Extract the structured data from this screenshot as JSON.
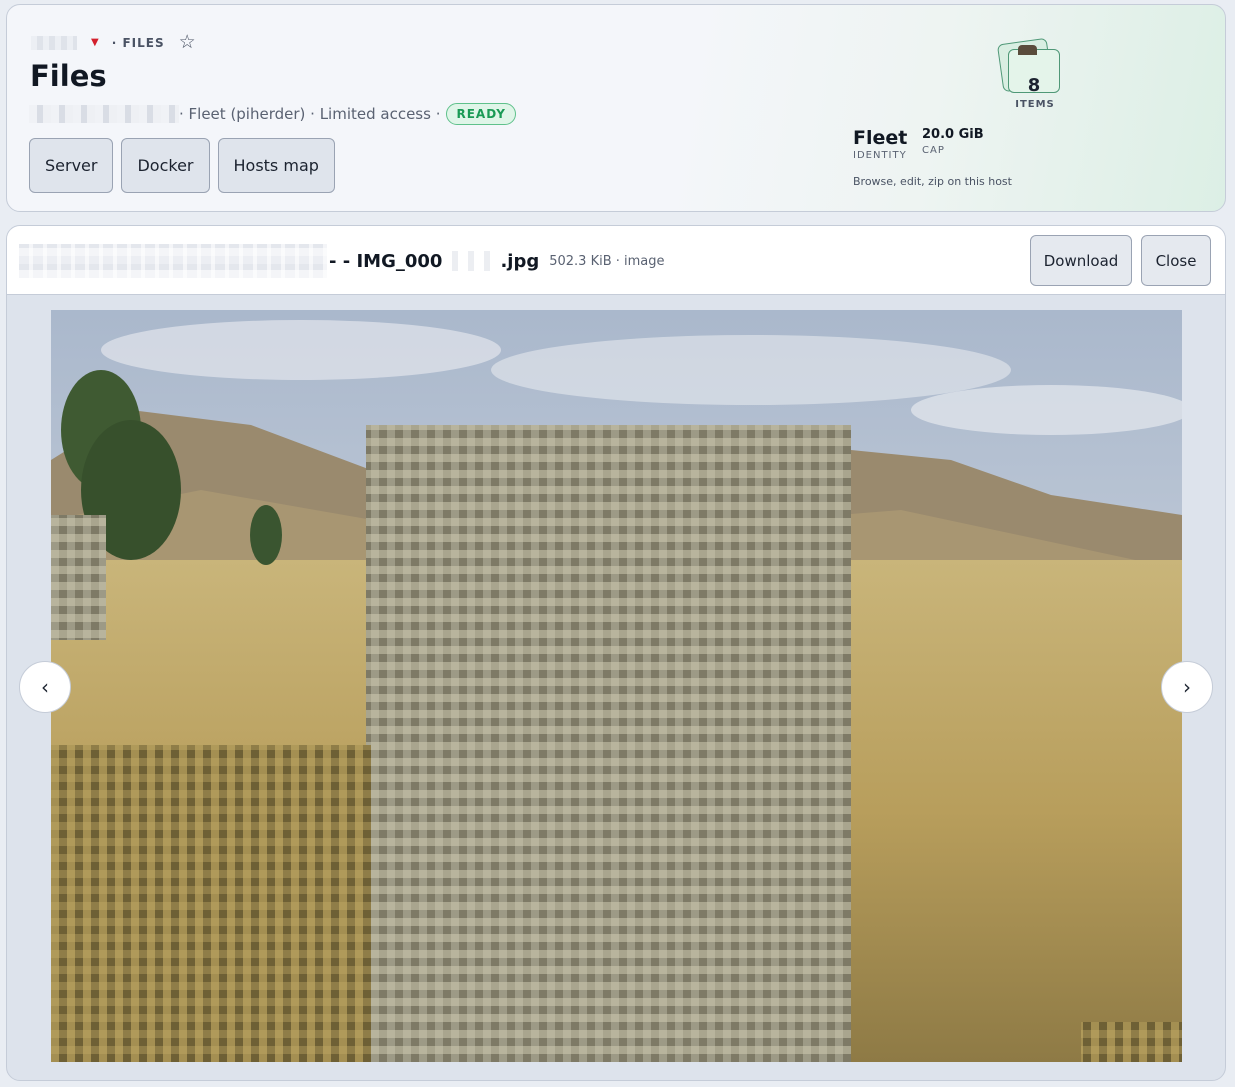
{
  "header": {
    "breadcrumb_label": "· FILES",
    "star_icon": "☆",
    "title": "Files",
    "meta": "· Fleet (piherder) · Limited access ·",
    "status_badge": "READY",
    "nav_buttons": [
      "Server",
      "Docker",
      "Hosts map"
    ],
    "items_count": "8",
    "items_label": "ITEMS",
    "identity_name": "Fleet",
    "identity_label": "IDENTITY",
    "cap_value": "20.0 GiB",
    "cap_label": "CAP",
    "host_description": "Browse, edit, zip on this host"
  },
  "viewer": {
    "file_name_start": "- - IMG_000",
    "file_name_end": ".jpg",
    "file_meta": "502.3 KiB · image",
    "download_label": "Download",
    "close_label": "Close",
    "prev_arrow": "‹",
    "next_arrow": "›"
  },
  "colors": {
    "ready_green": "#1a9a55",
    "caret_red": "#d3202d",
    "accent_teal": "#4f9877"
  }
}
